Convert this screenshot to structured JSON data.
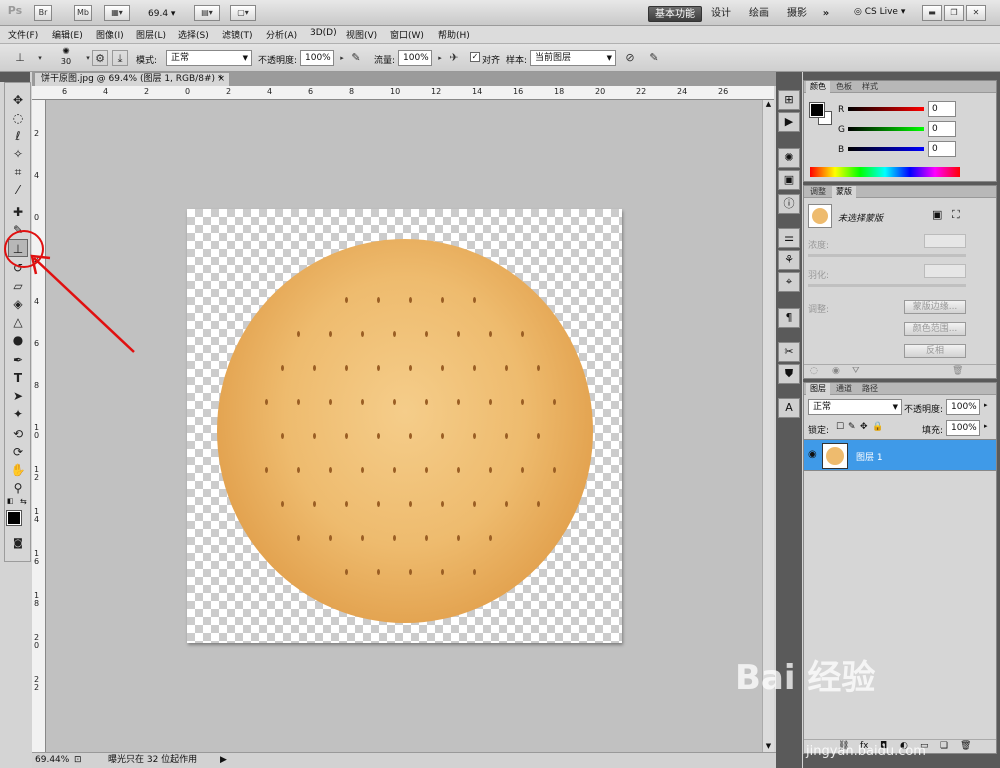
{
  "titlebar": {
    "logo": "Ps",
    "zoom": "69.4",
    "workspaces": [
      "基本功能",
      "设计",
      "绘画",
      "摄影"
    ],
    "more": "»",
    "cslive": "CS Live"
  },
  "menu": [
    "文件(F)",
    "编辑(E)",
    "图像(I)",
    "图层(L)",
    "选择(S)",
    "滤镜(T)",
    "分析(A)",
    "3D(D)",
    "视图(V)",
    "窗口(W)",
    "帮助(H)"
  ],
  "options": {
    "brush_size": "30",
    "mode_label": "模式:",
    "mode_value": "正常",
    "opacity_label": "不透明度:",
    "opacity_value": "100%",
    "flow_label": "流量:",
    "flow_value": "100%",
    "align_label": "对齐",
    "sample_label": "样本:",
    "sample_value": "当前图层"
  },
  "document": {
    "tab_label": "饼干原图.jpg @ 69.4% (图层 1, RGB/8#) *",
    "close": "×"
  },
  "ruler": {
    "h": [
      "6",
      "4",
      "2",
      "0",
      "2",
      "4",
      "6",
      "8",
      "10",
      "12",
      "14",
      "16",
      "18",
      "20",
      "22",
      "24",
      "26"
    ],
    "v": [
      "2",
      "4",
      "0",
      "2",
      "4",
      "6",
      "8",
      "1\n0",
      "1\n2",
      "1\n4",
      "1\n6",
      "1\n8",
      "2\n0",
      "2\n2"
    ]
  },
  "status": {
    "zoom": "69.44%",
    "info": "曝光只在 32 位起作用"
  },
  "color_panel": {
    "tabs": [
      "颜色",
      "色板",
      "样式"
    ],
    "r_label": "R",
    "r_value": "0",
    "g_label": "G",
    "g_value": "0",
    "b_label": "B",
    "b_value": "0"
  },
  "adjust_panel": {
    "tabs": [
      "调整",
      "蒙版"
    ],
    "no_mask": "未选择蒙版",
    "density": "浓度:",
    "feather": "羽化:",
    "refine": "调整:",
    "mask_edge": "蒙版边缘...",
    "color_range": "颜色范围...",
    "invert": "反相"
  },
  "layers_panel": {
    "tabs": [
      "图层",
      "通道",
      "路径"
    ],
    "blend": "正常",
    "opacity_label": "不透明度:",
    "opacity_value": "100%",
    "lock_label": "锁定:",
    "fill_label": "填充:",
    "fill_value": "100%",
    "layer_name": "图层 1"
  },
  "watermark": {
    "main": "Bai 经验",
    "sub": "jingyan.baidu.com"
  },
  "colors": {
    "accent": "#3f9ae8",
    "annotation": "#e01010"
  }
}
